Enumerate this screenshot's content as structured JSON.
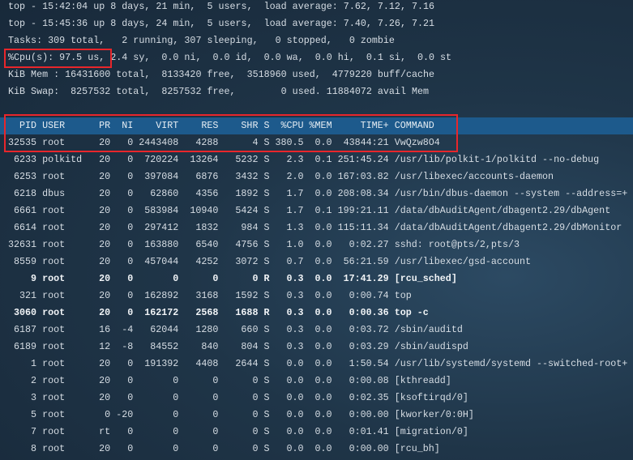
{
  "summary": {
    "top1": "top - 15:42:04 up 8 days, 21 min,  5 users,  load average: 7.62, 7.12, 7.16",
    "top2": "top - 15:45:36 up 8 days, 24 min,  5 users,  load average: 7.40, 7.26, 7.21",
    "tasks": "Tasks: 309 total,   2 running, 307 sleeping,   0 stopped,   0 zombie",
    "cpu_label": "%Cpu(s): 97.5 us,",
    "cpu_rest": " 2.4 sy,  0.0 ni,  0.0 id,  0.0 wa,  0.0 hi,  0.1 si,  0.0 st",
    "mem": "KiB Mem : 16431600 total,  8133420 free,  3518960 used,  4779220 buff/cache",
    "swap": "KiB Swap:  8257532 total,  8257532 free,        0 used. 11884072 avail Mem"
  },
  "columns": [
    "PID",
    "USER",
    "PR",
    "NI",
    "VIRT",
    "RES",
    "SHR",
    "S",
    "%CPU",
    "%MEM",
    "TIME+",
    "COMMAND"
  ],
  "processes": [
    {
      "pid": "32535",
      "user": "root",
      "pr": "20",
      "ni": "0",
      "virt": "2443408",
      "res": "4288",
      "shr": "4",
      "s": "S",
      "cpu": "380.5",
      "mem": "0.0",
      "time": "43844:21",
      "cmd": "VwQzw8O4"
    },
    {
      "pid": "6233",
      "user": "polkitd",
      "pr": "20",
      "ni": "0",
      "virt": "720224",
      "res": "13264",
      "shr": "5232",
      "s": "S",
      "cpu": "2.3",
      "mem": "0.1",
      "time": "251:45.24",
      "cmd": "/usr/lib/polkit-1/polkitd --no-debug"
    },
    {
      "pid": "6253",
      "user": "root",
      "pr": "20",
      "ni": "0",
      "virt": "397084",
      "res": "6876",
      "shr": "3432",
      "s": "S",
      "cpu": "2.0",
      "mem": "0.0",
      "time": "167:03.82",
      "cmd": "/usr/libexec/accounts-daemon"
    },
    {
      "pid": "6218",
      "user": "dbus",
      "pr": "20",
      "ni": "0",
      "virt": "62860",
      "res": "4356",
      "shr": "1892",
      "s": "S",
      "cpu": "1.7",
      "mem": "0.0",
      "time": "208:08.34",
      "cmd": "/usr/bin/dbus-daemon --system --address=+"
    },
    {
      "pid": "6661",
      "user": "root",
      "pr": "20",
      "ni": "0",
      "virt": "583984",
      "res": "10940",
      "shr": "5424",
      "s": "S",
      "cpu": "1.7",
      "mem": "0.1",
      "time": "199:21.11",
      "cmd": "/data/dbAuditAgent/dbagent2.29/dbAgent"
    },
    {
      "pid": "6614",
      "user": "root",
      "pr": "20",
      "ni": "0",
      "virt": "297412",
      "res": "1832",
      "shr": "984",
      "s": "S",
      "cpu": "1.3",
      "mem": "0.0",
      "time": "115:11.34",
      "cmd": "/data/dbAuditAgent/dbagent2.29/dbMonitor"
    },
    {
      "pid": "32631",
      "user": "root",
      "pr": "20",
      "ni": "0",
      "virt": "163880",
      "res": "6540",
      "shr": "4756",
      "s": "S",
      "cpu": "1.0",
      "mem": "0.0",
      "time": "0:02.27",
      "cmd": "sshd: root@pts/2,pts/3"
    },
    {
      "pid": "8559",
      "user": "root",
      "pr": "20",
      "ni": "0",
      "virt": "457044",
      "res": "4252",
      "shr": "3072",
      "s": "S",
      "cpu": "0.7",
      "mem": "0.0",
      "time": "56:21.59",
      "cmd": "/usr/libexec/gsd-account"
    },
    {
      "pid": "9",
      "user": "root",
      "pr": "20",
      "ni": "0",
      "virt": "0",
      "res": "0",
      "shr": "0",
      "s": "R",
      "cpu": "0.3",
      "mem": "0.0",
      "time": "17:41.29",
      "cmd": "[rcu_sched]",
      "bold": true
    },
    {
      "pid": "321",
      "user": "root",
      "pr": "20",
      "ni": "0",
      "virt": "162892",
      "res": "3168",
      "shr": "1592",
      "s": "S",
      "cpu": "0.3",
      "mem": "0.0",
      "time": "0:00.74",
      "cmd": "top"
    },
    {
      "pid": "3060",
      "user": "root",
      "pr": "20",
      "ni": "0",
      "virt": "162172",
      "res": "2568",
      "shr": "1688",
      "s": "R",
      "cpu": "0.3",
      "mem": "0.0",
      "time": "0:00.36",
      "cmd": "top -c",
      "bold": true
    },
    {
      "pid": "6187",
      "user": "root",
      "pr": "16",
      "ni": "-4",
      "virt": "62044",
      "res": "1280",
      "shr": "660",
      "s": "S",
      "cpu": "0.3",
      "mem": "0.0",
      "time": "0:03.72",
      "cmd": "/sbin/auditd"
    },
    {
      "pid": "6189",
      "user": "root",
      "pr": "12",
      "ni": "-8",
      "virt": "84552",
      "res": "840",
      "shr": "804",
      "s": "S",
      "cpu": "0.3",
      "mem": "0.0",
      "time": "0:03.29",
      "cmd": "/sbin/audispd"
    },
    {
      "pid": "1",
      "user": "root",
      "pr": "20",
      "ni": "0",
      "virt": "191392",
      "res": "4408",
      "shr": "2644",
      "s": "S",
      "cpu": "0.0",
      "mem": "0.0",
      "time": "1:50.54",
      "cmd": "/usr/lib/systemd/systemd --switched-root+"
    },
    {
      "pid": "2",
      "user": "root",
      "pr": "20",
      "ni": "0",
      "virt": "0",
      "res": "0",
      "shr": "0",
      "s": "S",
      "cpu": "0.0",
      "mem": "0.0",
      "time": "0:00.08",
      "cmd": "[kthreadd]"
    },
    {
      "pid": "3",
      "user": "root",
      "pr": "20",
      "ni": "0",
      "virt": "0",
      "res": "0",
      "shr": "0",
      "s": "S",
      "cpu": "0.0",
      "mem": "0.0",
      "time": "0:02.35",
      "cmd": "[ksoftirqd/0]"
    },
    {
      "pid": "5",
      "user": "root",
      "pr": "0",
      "ni": "-20",
      "virt": "0",
      "res": "0",
      "shr": "0",
      "s": "S",
      "cpu": "0.0",
      "mem": "0.0",
      "time": "0:00.00",
      "cmd": "[kworker/0:0H]"
    },
    {
      "pid": "7",
      "user": "root",
      "pr": "rt",
      "ni": "0",
      "virt": "0",
      "res": "0",
      "shr": "0",
      "s": "S",
      "cpu": "0.0",
      "mem": "0.0",
      "time": "0:01.41",
      "cmd": "[migration/0]"
    },
    {
      "pid": "8",
      "user": "root",
      "pr": "20",
      "ni": "0",
      "virt": "0",
      "res": "0",
      "shr": "0",
      "s": "S",
      "cpu": "0.0",
      "mem": "0.0",
      "time": "0:00.00",
      "cmd": "[rcu_bh]"
    }
  ],
  "colors": {
    "highlight": "#1d5a8c",
    "annotation": "#e8262b"
  }
}
